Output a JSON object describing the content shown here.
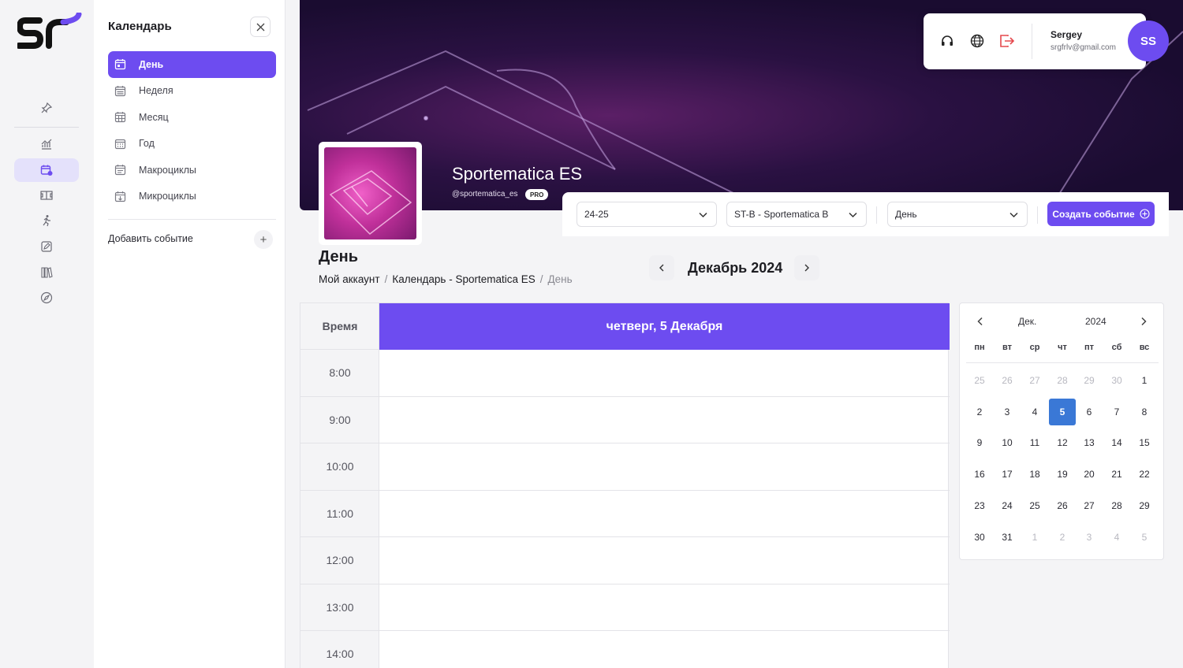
{
  "brand": {
    "logo_text": "SR",
    "accent": "#6d4cf0"
  },
  "rail": {
    "items": [
      {
        "icon": "pin-icon"
      },
      {
        "icon": "analytics-icon"
      },
      {
        "icon": "calendar-icon",
        "active": true
      },
      {
        "icon": "field-icon"
      },
      {
        "icon": "runner-icon"
      },
      {
        "icon": "edit-icon"
      },
      {
        "icon": "library-icon"
      },
      {
        "icon": "compass-icon"
      }
    ]
  },
  "panel": {
    "title": "Календарь",
    "items": [
      {
        "label": "День",
        "active": true
      },
      {
        "label": "Неделя"
      },
      {
        "label": "Месяц"
      },
      {
        "label": "Год"
      },
      {
        "label": "Макроциклы"
      },
      {
        "label": "Микроциклы"
      }
    ],
    "add_event": "Добавить событие"
  },
  "user": {
    "name": "Sergey",
    "email": "srgfrlv@gmail.com",
    "initials": "SS"
  },
  "team": {
    "name": "Sportematica ES",
    "handle": "@sportematica_es",
    "badge": "PRO"
  },
  "filters": {
    "season": "24-25",
    "team": "ST-B - Sportematica B",
    "view": "День",
    "create_label": "Создать событие"
  },
  "page": {
    "title": "День",
    "breadcrumb": [
      "Мой аккаунт",
      "Календарь - Sportematica ES",
      "День"
    ],
    "month_label": "Декабрь 2024"
  },
  "day_view": {
    "time_header": "Время",
    "day_header": "четверг, 5 Декабря",
    "times": [
      "8:00",
      "9:00",
      "10:00",
      "11:00",
      "12:00",
      "13:00",
      "14:00"
    ]
  },
  "mini_calendar": {
    "month": "Дек.",
    "year": "2024",
    "weekdays": [
      "пн",
      "вт",
      "ср",
      "чт",
      "пт",
      "сб",
      "вс"
    ],
    "weeks": [
      [
        "25",
        "26",
        "27",
        "28",
        "29",
        "30",
        "1"
      ],
      [
        "2",
        "3",
        "4",
        "5",
        "6",
        "7",
        "8"
      ],
      [
        "9",
        "10",
        "11",
        "12",
        "13",
        "14",
        "15"
      ],
      [
        "16",
        "17",
        "18",
        "19",
        "20",
        "21",
        "22"
      ],
      [
        "23",
        "24",
        "25",
        "26",
        "27",
        "28",
        "29"
      ],
      [
        "30",
        "31",
        "1",
        "2",
        "3",
        "4",
        "5"
      ]
    ],
    "selected": "5",
    "selected_color": "#3a78d6"
  }
}
